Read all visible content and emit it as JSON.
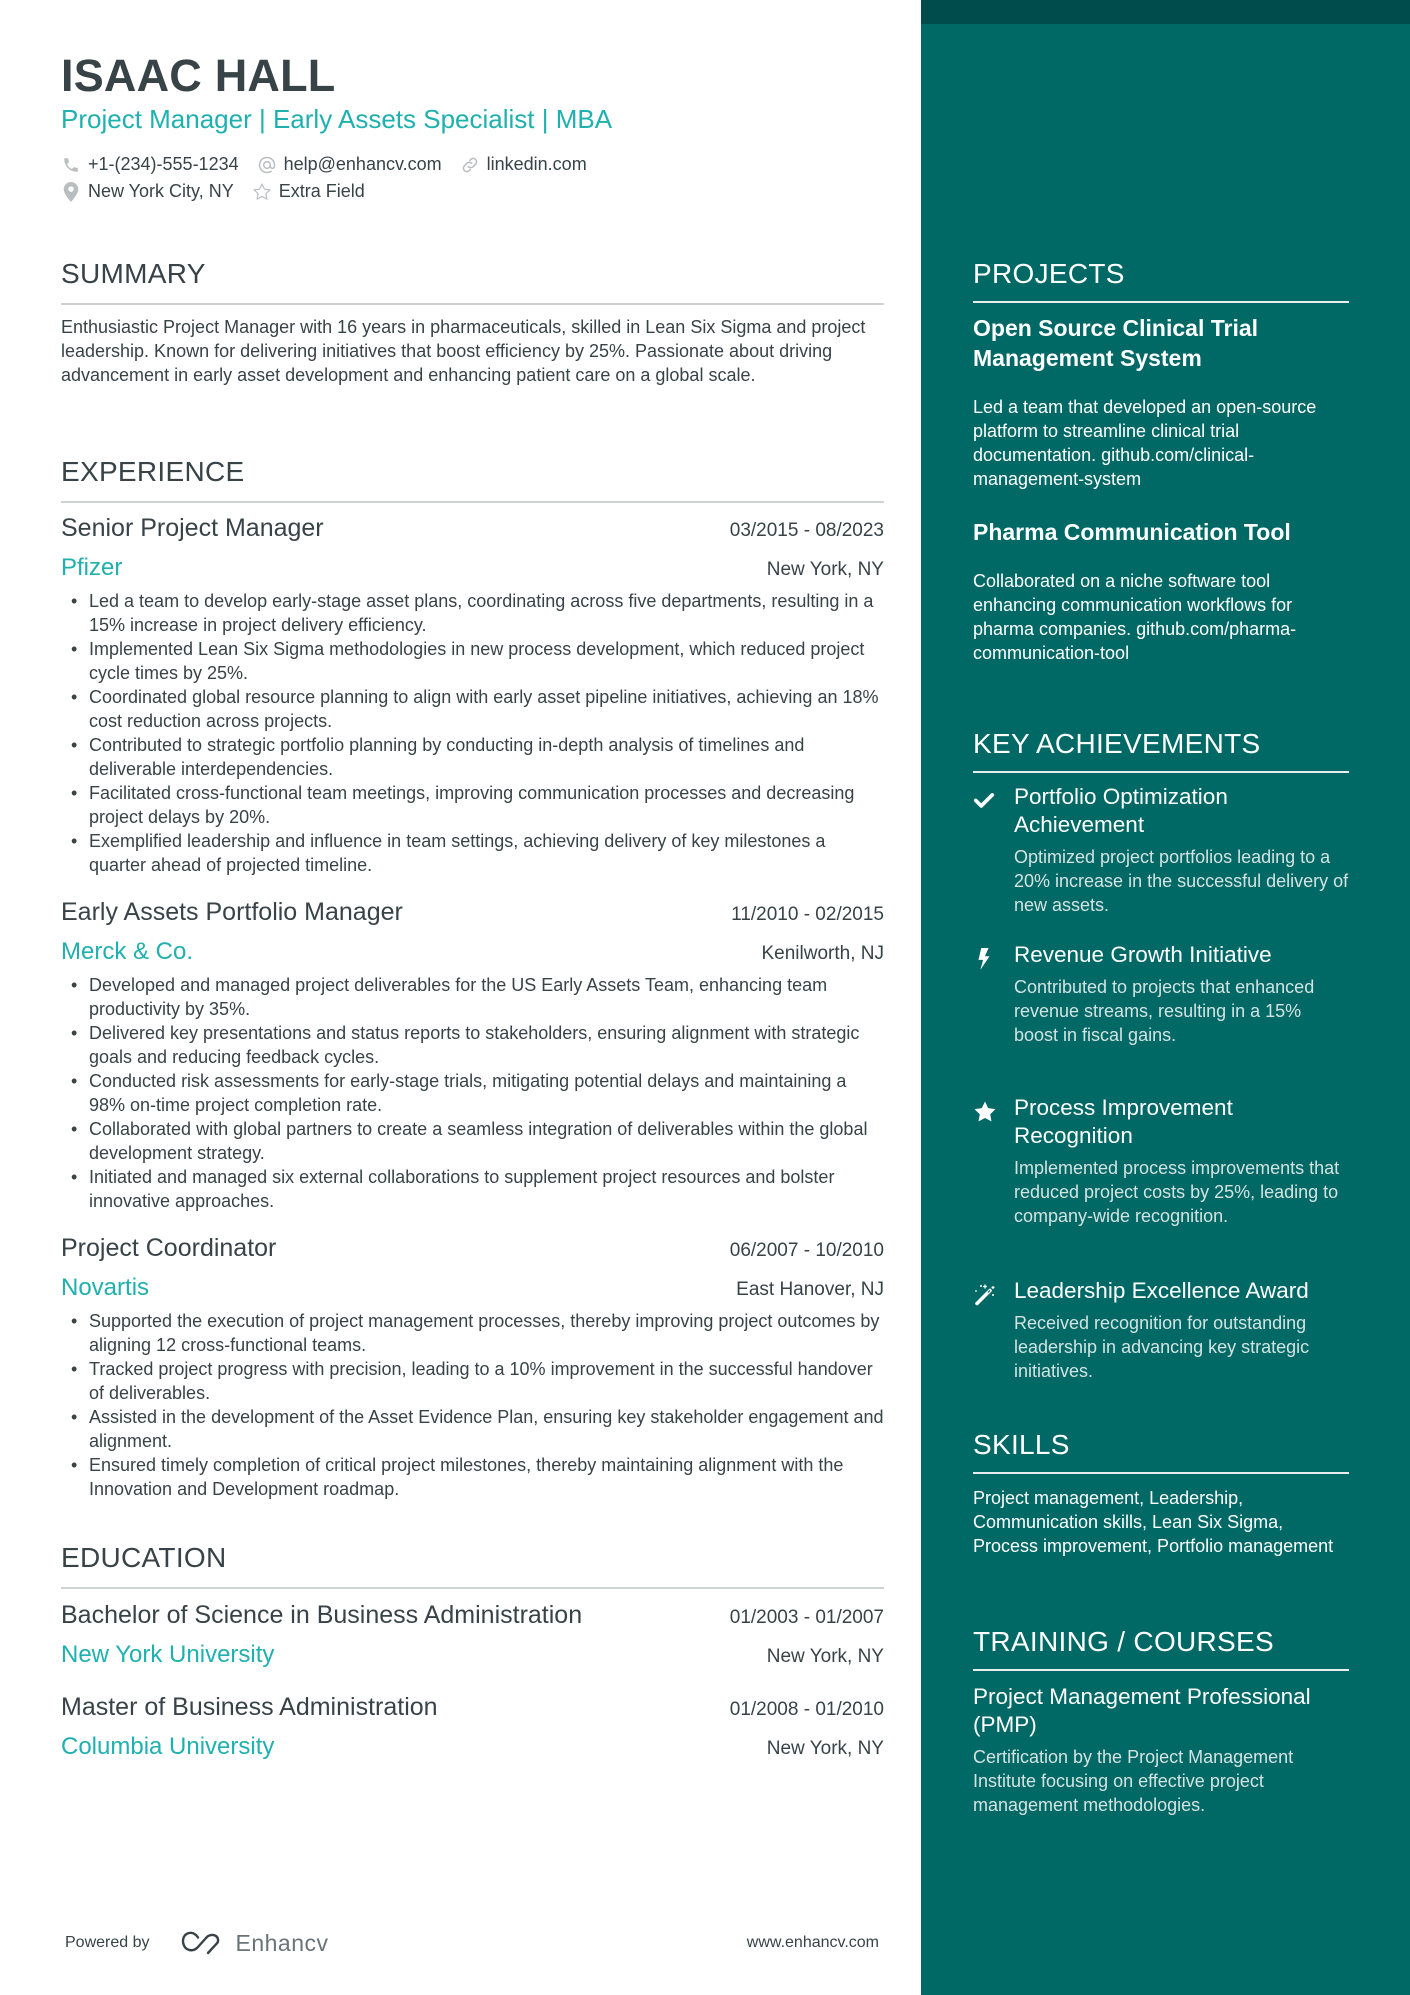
{
  "colors": {
    "accent": "#1fb0b0",
    "text": "#384347",
    "sidebar_bg": "#006966",
    "sidebar_top_band": "#004b4b",
    "rule": "#cfd2d3"
  },
  "header": {
    "name": "ISAAC HALL",
    "headline": "Project Manager | Early Assets Specialist | MBA",
    "contacts": [
      {
        "icon": "phone-icon",
        "text": "+1-(234)-555-1234"
      },
      {
        "icon": "at-icon",
        "text": "help@enhancv.com"
      },
      {
        "icon": "link-icon",
        "text": "linkedin.com"
      },
      {
        "icon": "location-pin-icon",
        "text": "New York City, NY"
      },
      {
        "icon": "star-outline-icon",
        "text": "Extra Field"
      }
    ]
  },
  "summary": {
    "title": "SUMMARY",
    "text": "Enthusiastic Project Manager with 16 years in pharmaceuticals, skilled in Lean Six Sigma and project leadership. Known for delivering initiatives that boost efficiency by 25%. Passionate about driving advancement in early asset development and enhancing patient care on a global scale."
  },
  "experience": {
    "title": "EXPERIENCE",
    "jobs": [
      {
        "title": "Senior Project Manager",
        "dates": "03/2015 - 08/2023",
        "company": "Pfizer",
        "location": "New York, NY",
        "bullets": [
          "Led a team to develop early-stage asset plans, coordinating across five departments, resulting in a 15% increase in project delivery efficiency.",
          "Implemented Lean Six Sigma methodologies in new process development, which reduced project cycle times by 25%.",
          "Coordinated global resource planning to align with early asset pipeline initiatives, achieving an 18% cost reduction across projects.",
          "Contributed to strategic portfolio planning by conducting in-depth analysis of timelines and deliverable interdependencies.",
          "Facilitated cross-functional team meetings, improving communication processes and decreasing project delays by 20%.",
          "Exemplified leadership and influence in team settings, achieving delivery of key milestones a quarter ahead of projected timeline."
        ]
      },
      {
        "title": "Early Assets Portfolio Manager",
        "dates": "11/2010 - 02/2015",
        "company": "Merck & Co.",
        "location": "Kenilworth, NJ",
        "bullets": [
          "Developed and managed project deliverables for the US Early Assets Team, enhancing team productivity by 35%.",
          "Delivered key presentations and status reports to stakeholders, ensuring alignment with strategic goals and reducing feedback cycles.",
          "Conducted risk assessments for early-stage trials, mitigating potential delays and maintaining a 98% on-time project completion rate.",
          "Collaborated with global partners to create a seamless integration of deliverables within the global development strategy.",
          "Initiated and managed six external collaborations to supplement project resources and bolster innovative approaches."
        ]
      },
      {
        "title": "Project Coordinator",
        "dates": "06/2007 - 10/2010",
        "company": "Novartis",
        "location": "East Hanover, NJ",
        "bullets": [
          "Supported the execution of project management processes, thereby improving project outcomes by aligning 12 cross-functional teams.",
          "Tracked project progress with precision, leading to a 10% improvement in the successful handover of deliverables.",
          "Assisted in the development of the Asset Evidence Plan, ensuring key stakeholder engagement and alignment.",
          "Ensured timely completion of critical project milestones, thereby maintaining alignment with the Innovation and Development roadmap."
        ]
      }
    ]
  },
  "education": {
    "title": "EDUCATION",
    "items": [
      {
        "degree": "Bachelor of Science in Business Administration",
        "dates": "01/2003 - 01/2007",
        "school": "New York University",
        "location": "New York, NY"
      },
      {
        "degree": "Master of Business Administration",
        "dates": "01/2008 - 01/2010",
        "school": "Columbia University",
        "location": "New York, NY"
      }
    ]
  },
  "footer": {
    "powered_by": "Powered by",
    "brand": "Enhancv",
    "website": "www.enhancv.com"
  },
  "sidebar": {
    "projects": {
      "title": "PROJECTS",
      "items": [
        {
          "title": "Open Source Clinical Trial Management System",
          "description": "Led a team that developed an open-source platform to streamline clinical trial documentation. github.com/clinical-management-system"
        },
        {
          "title": "Pharma Communication Tool",
          "description": "Collaborated on a niche software tool enhancing communication workflows for pharma companies. github.com/pharma-communication-tool"
        }
      ]
    },
    "achievements": {
      "title": "KEY ACHIEVEMENTS",
      "items": [
        {
          "icon": "checkmark-icon",
          "title": "Portfolio Optimization Achievement",
          "description": "Optimized project portfolios leading to a 20% increase in the successful delivery of new assets."
        },
        {
          "icon": "lightning-bolt-icon",
          "title": "Revenue Growth Initiative",
          "description": "Contributed to projects that enhanced revenue streams, resulting in a 15% boost in fiscal gains."
        },
        {
          "icon": "star-icon",
          "title": "Process Improvement Recognition",
          "description": "Implemented process improvements that reduced project costs by 25%, leading to company-wide recognition."
        },
        {
          "icon": "magic-wand-icon",
          "title": "Leadership Excellence Award",
          "description": "Received recognition for outstanding leadership in advancing key strategic initiatives."
        }
      ]
    },
    "skills": {
      "title": "SKILLS",
      "text": "Project management, Leadership, Communication skills, Lean Six Sigma, Process improvement, Portfolio management"
    },
    "training": {
      "title": "TRAINING / COURSES",
      "items": [
        {
          "title": "Project Management Professional (PMP)",
          "description": "Certification by the Project Management Institute focusing on effective project management methodologies."
        }
      ]
    }
  }
}
